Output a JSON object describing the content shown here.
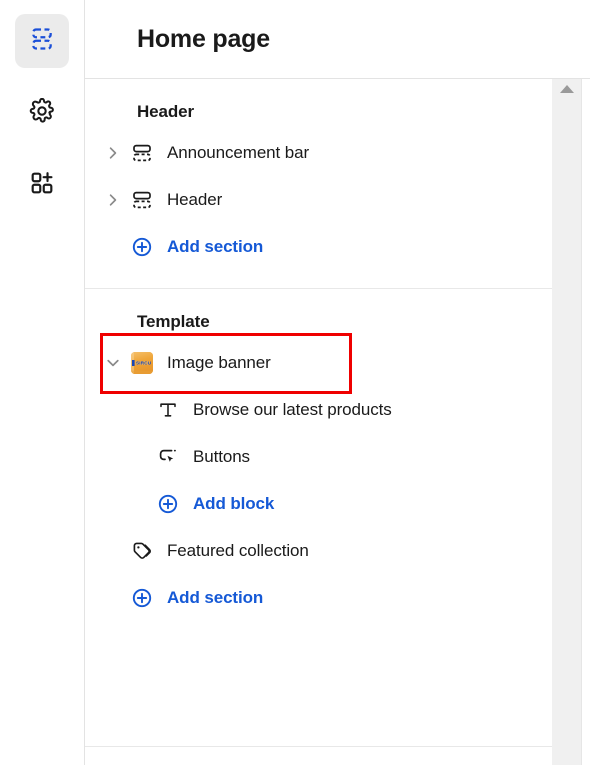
{
  "rail": {
    "items": [
      {
        "name": "sections-icon",
        "label": "Sections",
        "active": true
      },
      {
        "name": "settings-gear-icon",
        "label": "Theme settings",
        "active": false
      },
      {
        "name": "apps-add-icon",
        "label": "Apps",
        "active": false
      }
    ]
  },
  "header": {
    "title": "Home page"
  },
  "groups": [
    {
      "title": "Header",
      "rows": [
        {
          "label": "Announcement bar",
          "icon": "section-icon",
          "twisty": "chevron-right",
          "kind": "section"
        },
        {
          "label": "Header",
          "icon": "section-icon",
          "twisty": "chevron-right",
          "kind": "section"
        },
        {
          "label": "Add section",
          "icon": "plus-circle-icon",
          "kind": "action"
        }
      ]
    },
    {
      "title": "Template",
      "rows": [
        {
          "label": "Image banner",
          "icon": "image-thumbnail",
          "twisty": "chevron-down",
          "kind": "section",
          "highlighted": true
        },
        {
          "label": "Browse our latest products",
          "icon": "text-block-icon",
          "kind": "block"
        },
        {
          "label": "Buttons",
          "icon": "button-block-icon",
          "kind": "block"
        },
        {
          "label": "Add block",
          "icon": "plus-circle-icon",
          "kind": "nested-action"
        },
        {
          "label": "Featured collection",
          "icon": "collection-tag-icon",
          "kind": "leaf"
        },
        {
          "label": "Add section",
          "icon": "plus-circle-icon",
          "kind": "action"
        }
      ]
    }
  ],
  "scrollbar": {
    "up_arrow": "scroll-up-arrow"
  },
  "colors": {
    "accent_blue": "#1559d6",
    "annotation_red": "#ef0000",
    "thumb_orange": "#f0a63c"
  }
}
